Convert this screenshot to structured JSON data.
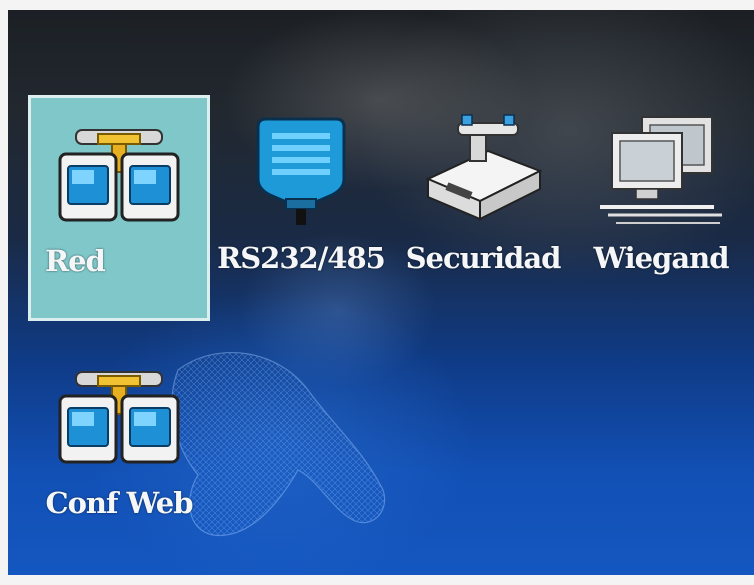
{
  "menu": {
    "items": [
      {
        "label": "Red",
        "icon": "network-icon",
        "selected": true
      },
      {
        "label": "RS232/485",
        "icon": "serial-connector-icon",
        "selected": false
      },
      {
        "label": "Securidad",
        "icon": "security-device-icon",
        "selected": false
      },
      {
        "label": "Wiegand",
        "icon": "computer-terminal-icon",
        "selected": false
      },
      {
        "label": "Conf Web",
        "icon": "network-icon",
        "selected": false
      }
    ]
  },
  "colors": {
    "selection": "#7fc7c9",
    "label": "#f4f6f8",
    "background_top": "#1c2025",
    "background_bottom": "#1457c0"
  }
}
